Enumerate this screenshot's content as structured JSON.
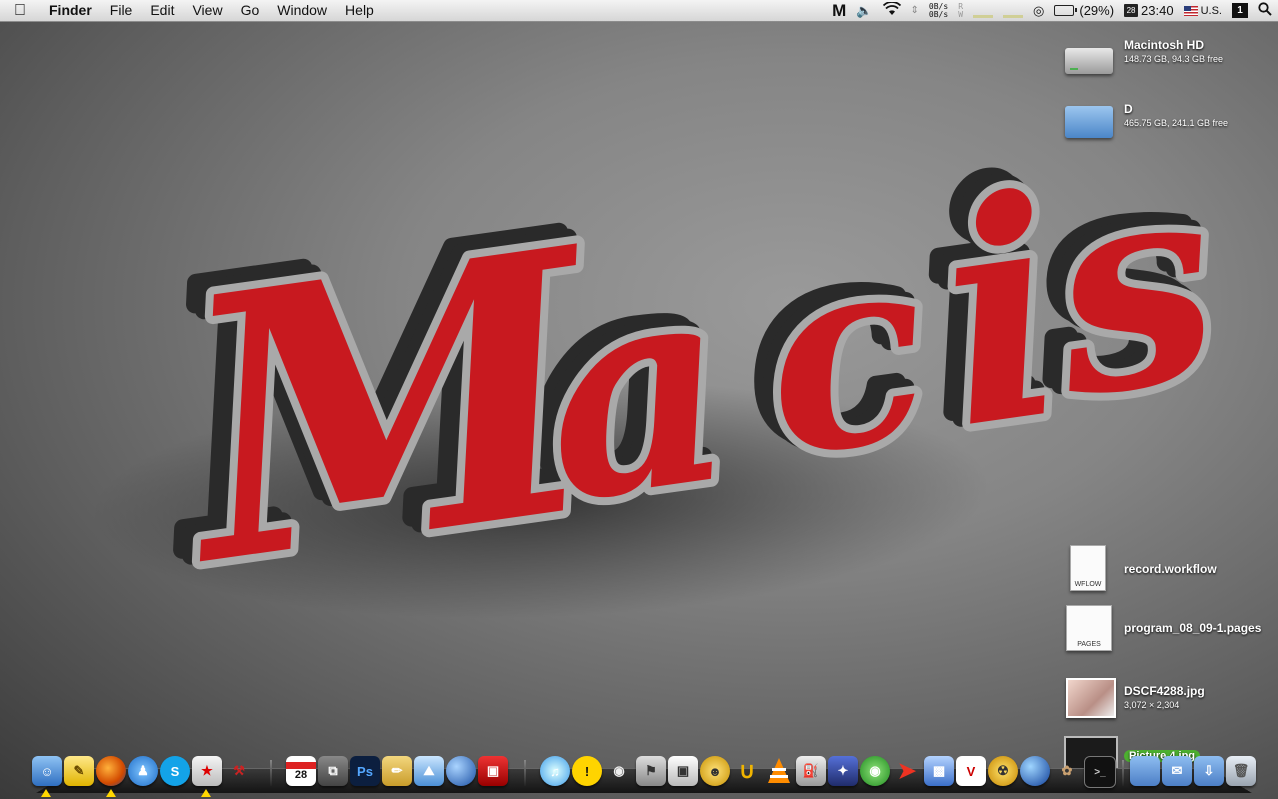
{
  "menubar": {
    "apple_icon": "apple-logo-icon",
    "app_name": "Finder",
    "menus": [
      "File",
      "Edit",
      "View",
      "Go",
      "Window",
      "Help"
    ],
    "status": {
      "net_up": "0B/s",
      "net_down": "0B/s",
      "disk_r": "R",
      "disk_w": "W",
      "battery": "(29%)",
      "calendar_day": "28",
      "time": "23:40",
      "input_source": "U.S.",
      "space_number": "1"
    }
  },
  "wallpaper": {
    "text": "Macis",
    "colors": {
      "fill": "#c8191f",
      "rim": "#a9a9a9",
      "side": "#2a2a2a"
    }
  },
  "desktop_icons": [
    {
      "name": "Macintosh HD",
      "sub": "148.73 GB, 94.3 GB free"
    },
    {
      "name": "D",
      "sub": "465.75 GB, 241.1 GB free"
    },
    {
      "name": "record.workflow",
      "sub": "",
      "badge": "WFLOW"
    },
    {
      "name": "program_08_09-1.pages",
      "sub": "",
      "badge": "PAGES"
    },
    {
      "name": "DSCF4288.jpg",
      "sub": "3,072 × 2,304"
    },
    {
      "name": "Picture 4.jpg",
      "sub": ""
    }
  ],
  "dock": {
    "calendar_day": "28",
    "photoshop": "Ps",
    "vnc": "V"
  }
}
